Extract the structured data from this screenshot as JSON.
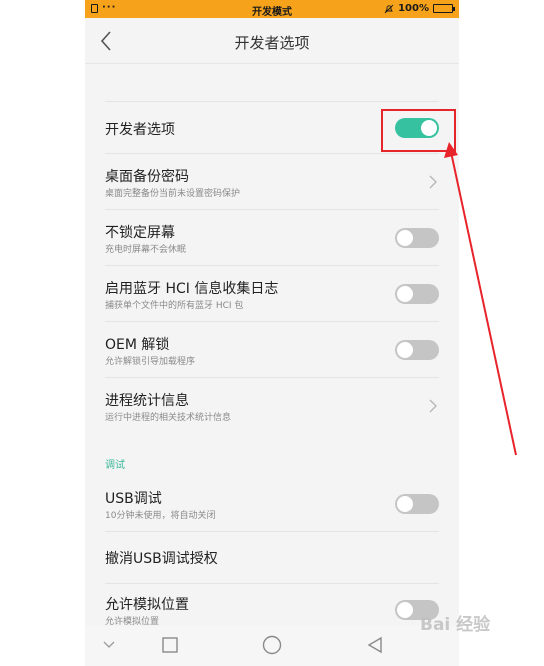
{
  "status_bar": {
    "title": "开发模式",
    "dots": "···",
    "battery": "100%"
  },
  "header": {
    "title": "开发者选项"
  },
  "rows": [
    {
      "title": "开发者选项",
      "subtitle": "",
      "control": "toggle",
      "checked": true
    },
    {
      "title": "桌面备份密码",
      "subtitle": "桌面完整备份当前未设置密码保护",
      "control": "chevron"
    },
    {
      "title": "不锁定屏幕",
      "subtitle": "充电时屏幕不会休眠",
      "control": "toggle",
      "checked": false
    },
    {
      "title": "启用蓝牙 HCI 信息收集日志",
      "subtitle": "捕获单个文件中的所有蓝牙 HCI 包",
      "control": "toggle",
      "checked": false
    },
    {
      "title": "OEM 解锁",
      "subtitle": "允许解锁引导加载程序",
      "control": "toggle",
      "checked": false
    },
    {
      "title": "进程统计信息",
      "subtitle": "运行中进程的相关技术统计信息",
      "control": "chevron"
    }
  ],
  "section": {
    "label": "调试"
  },
  "debug_rows": [
    {
      "title": "USB调试",
      "subtitle": "10分钟未使用，将自动关闭",
      "control": "toggle",
      "checked": false
    },
    {
      "title": "撤消USB调试授权",
      "subtitle": "",
      "control": "none"
    },
    {
      "title": "允许模拟位置",
      "subtitle": "允许模拟位置",
      "control": "toggle",
      "checked": false
    }
  ],
  "colors": {
    "status_bar": "#f6a21b",
    "toggle_on": "#36c2a1",
    "toggle_off": "#c5c5c5",
    "section_accent": "#3bb89a",
    "annotation": "#e8242b"
  },
  "nav_bar": {
    "icons": [
      "chevron-down-icon",
      "recent-apps-icon",
      "home-icon",
      "back-triangle-icon"
    ]
  },
  "watermark": {
    "text": "Bai 经验"
  }
}
